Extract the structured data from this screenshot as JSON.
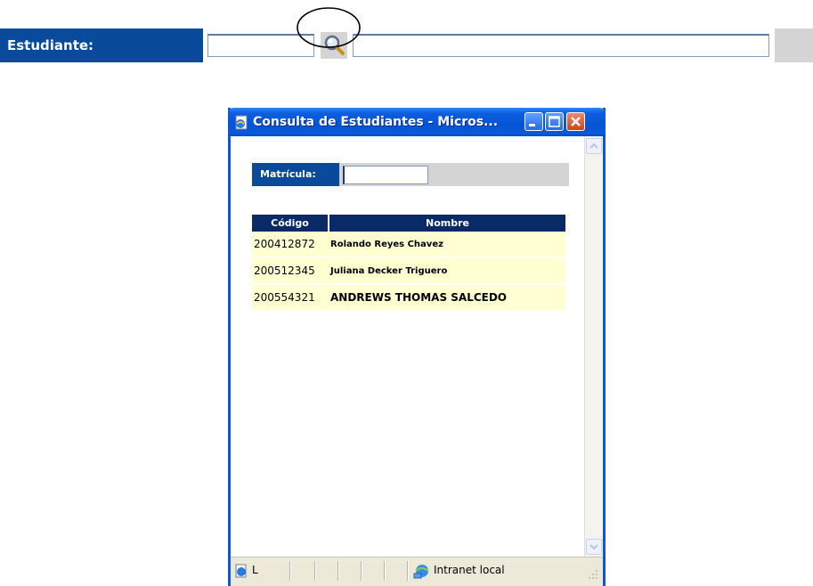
{
  "form": {
    "label": "Estudiante:",
    "code_value": "",
    "name_value": "",
    "search_icon": "magnifier-icon"
  },
  "popup": {
    "title": "Consulta de Estudiantes - Micros...",
    "title_icon": "ie-page-icon",
    "matricula_label": "Matrícula:",
    "matricula_value": "",
    "table": {
      "headers": [
        "Código",
        "Nombre"
      ],
      "rows": [
        {
          "code": "200412872",
          "name": "Rolando Reyes Chavez"
        },
        {
          "code": "200512345",
          "name": "Juliana Decker Triguero"
        },
        {
          "code": "200554321",
          "name": "ANDREWS THOMAS SALCEDO"
        }
      ]
    },
    "status": {
      "left_text": "L",
      "zone_text": "Intranet local"
    }
  },
  "colors": {
    "label_blue": "#0a4a9a",
    "header_navy": "#0a2a66",
    "row_yellow": "#ffffd2",
    "titlebar_blue": "#0654d6"
  }
}
